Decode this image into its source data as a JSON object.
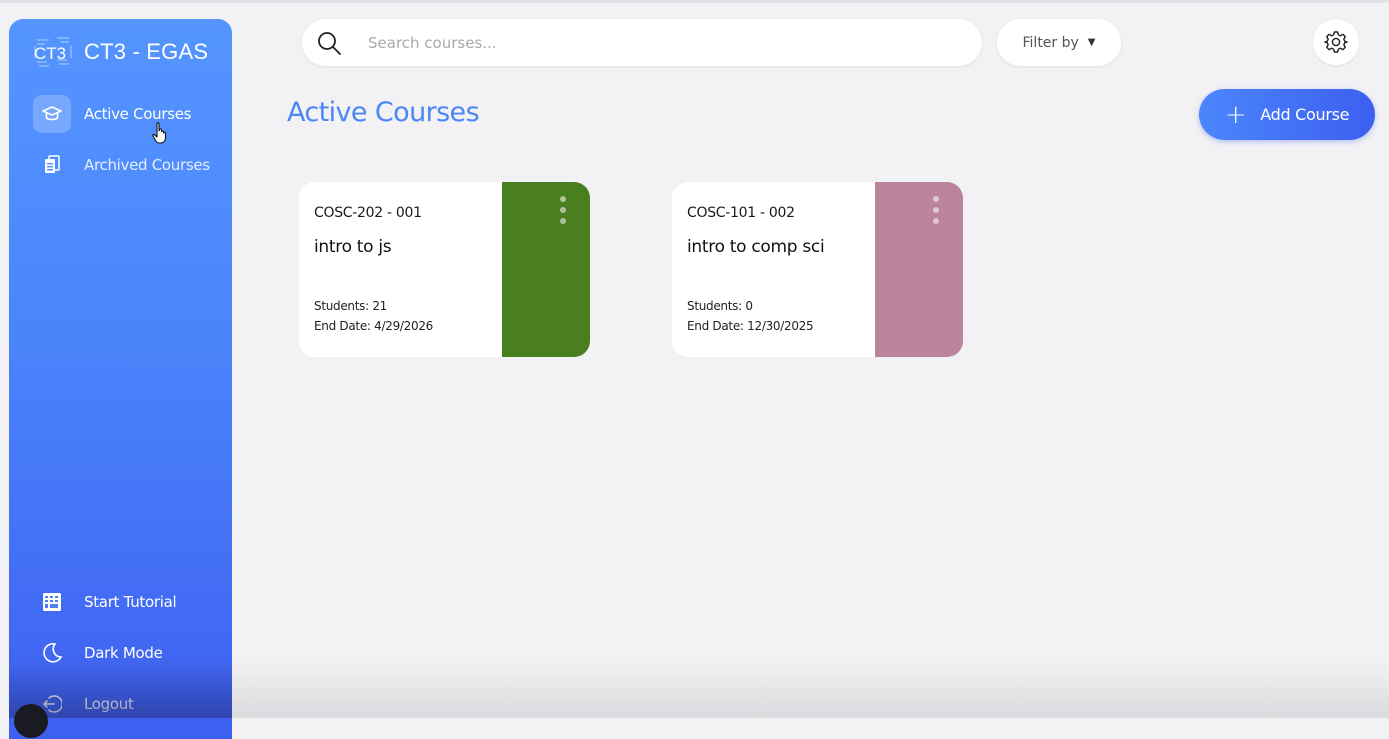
{
  "sidebar": {
    "brand_logo_text": "CT3",
    "brand_title": "CT3 - EGAS",
    "nav_items": [
      {
        "label": "Active Courses",
        "icon": "graduation-cap-icon",
        "active": true
      },
      {
        "label": "Archived Courses",
        "icon": "archive-icon",
        "active": false
      }
    ],
    "bottom_items": [
      {
        "label": "Start Tutorial",
        "icon": "keyboard-icon"
      },
      {
        "label": "Dark Mode",
        "icon": "moon-icon"
      },
      {
        "label": "Logout",
        "icon": "logout-icon"
      }
    ]
  },
  "search": {
    "placeholder": "Search courses...",
    "value": ""
  },
  "filter": {
    "label": "Filter by"
  },
  "main": {
    "title": "Active Courses",
    "add_button_label": "Add Course"
  },
  "courses": [
    {
      "code": "COSC-202 - 001",
      "name": "intro to js",
      "students": "Students: 21",
      "end_date": "End Date: 4/29/2026",
      "color": "#4a7f1f"
    },
    {
      "code": "COSC-101 - 002",
      "name": "intro to comp sci",
      "students": "Students: 0",
      "end_date": "End Date: 12/30/2025",
      "color": "#bb839c"
    }
  ],
  "colors": {
    "accent": "#4a86f5",
    "sidebar_top": "#5595ff",
    "sidebar_bottom": "#3e5ff0",
    "background": "#f2f2f4"
  }
}
